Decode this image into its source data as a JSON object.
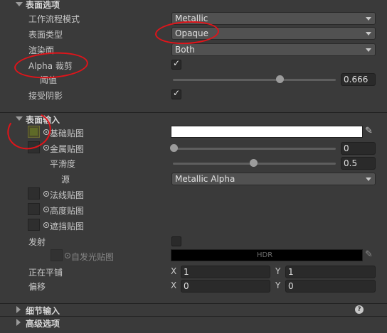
{
  "surface_options": {
    "header": "表面选项",
    "workflow": {
      "label": "工作流程模式",
      "value": "Metallic"
    },
    "surface_type": {
      "label": "表面类型",
      "value": "Opaque"
    },
    "render_face": {
      "label": "渲染面",
      "value": "Both"
    },
    "alpha_clip": {
      "label": "Alpha 裁剪",
      "checked": true
    },
    "threshold": {
      "label": "阈值",
      "value": "0.666",
      "fraction": 0.666
    },
    "receive_shadows": {
      "label": "接受阴影",
      "checked": true
    }
  },
  "surface_inputs": {
    "header": "表面输入",
    "base_map": {
      "label": "基础贴图",
      "color": "#ffffff"
    },
    "metallic_map": {
      "label": "金属贴图",
      "value": "0",
      "fraction": 0.0
    },
    "smoothness": {
      "label": "平滑度",
      "value": "0.5",
      "fraction": 0.5
    },
    "source": {
      "label": "源",
      "value": "Metallic Alpha"
    },
    "normal_map": {
      "label": "法线贴图"
    },
    "height_map": {
      "label": "高度贴图"
    },
    "occlusion_map": {
      "label": "遮挡贴图"
    },
    "emission": {
      "label": "发射",
      "checked": false
    },
    "emission_map": {
      "label": "自发光贴图",
      "hdr_label": "HDR",
      "color": "#000000"
    },
    "tiling": {
      "label": "正在平铺",
      "x_label": "X",
      "x": "1",
      "y_label": "Y",
      "y": "1"
    },
    "offset": {
      "label": "偏移",
      "x_label": "X",
      "x": "0",
      "y_label": "Y",
      "y": "0"
    }
  },
  "detail_inputs": {
    "header": "细节输入",
    "help_icon": "help-icon"
  },
  "advanced_options": {
    "header": "高级选项"
  },
  "colors": {
    "annotation": "#e0141a",
    "panel": "#3a3a3a"
  }
}
